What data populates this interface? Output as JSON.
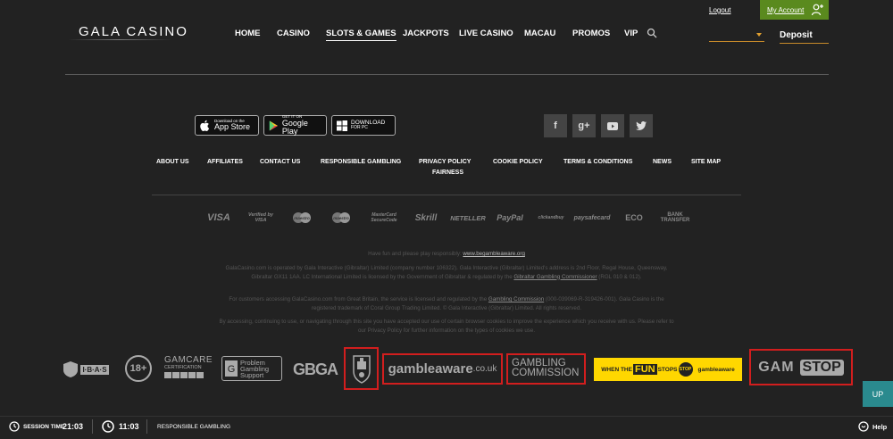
{
  "header": {
    "logo": "GALA CASINO",
    "nav": [
      "HOME",
      "CASINO",
      "SLOTS & GAMES",
      "JACKPOTS",
      "LIVE CASINO",
      "MACAU",
      "PROMOS",
      "VIP"
    ],
    "active_nav": "SLOTS & GAMES",
    "logout": "Logout",
    "my_account": "My Account",
    "deposit": "Deposit",
    "dropdown_value": ""
  },
  "apps": {
    "app_store": {
      "small": "Download on the",
      "big": "App Store"
    },
    "google_play": {
      "small": "GET IT ON",
      "big": "Google Play"
    },
    "windows": {
      "small": "DOWNLOAD",
      "big": "FOR PC"
    }
  },
  "social": [
    "f",
    "g+",
    "yt",
    "tw"
  ],
  "footer_links": [
    "ABOUT US",
    "AFFILIATES",
    "CONTACT US",
    "RESPONSIBLE GAMBLING",
    "PRIVACY POLICY",
    "FAIRNESS",
    "COOKIE POLICY",
    "TERMS & CONDITIONS",
    "NEWS",
    "SITE MAP"
  ],
  "payments": [
    "VISA",
    "Verified by VISA",
    "maestro",
    "maestro",
    "MasterCard SecureCode",
    "Skrill",
    "NETELLER",
    "PayPal",
    "clickandbuy",
    "paysafecard",
    "ECO",
    "BANK TRANSFER"
  ],
  "legal": {
    "line1_prefix": "Have fun and please play responsibly: ",
    "line1_link": "www.begambleaware.org",
    "para1": "GalaCasino.com is operated by Gala Interactive (Gibraltar) Limited (company number 106322). Gala Interactive (Gibraltar) Limited's address is 2nd Floor, Regal House, Queensway, Gibraltar GX11 1AA. LC International Limited is licensed by the Government of Gibraltar & regulated by the",
    "para1_link": "Gibraltar Gambling Commissioner",
    "para1_suffix": " (RGL 010 & 012).",
    "para2_prefix": "For customers accessing GalaCasino.com from Great Britain, the service is licensed and regulated by the ",
    "para2_link": "Gambling Commission",
    "para2_suffix": " (000-039069-R-319426-001). Gala Casino is the registered trademark of Coral Group Trading Limited. © Gala Interactive (Gibraltar) Limited. All rights reserved.",
    "para3": "By accessing, continuing to use, or navigating through this site you have accepted our use of certain browser cookies to improve the experience which you receive with us. Please refer to our Privacy Policy for further information on the types of cookies we use."
  },
  "badges": {
    "ibas": "I·B·A·S",
    "age": "18+",
    "gamcare_top": "GAMCARE",
    "gamcare_bottom": "CERTIFICATION",
    "pgs": [
      "Problem",
      "Gambling",
      "Support"
    ],
    "gbga": "GBGA",
    "gambleaware_main": "gambleaware",
    "gambleaware_suffix": ".co.uk",
    "gc_top": "GAMBLING",
    "gc_bottom": "COMMISSION",
    "fun_prefix": "WHEN THE ",
    "fun_word": "FUN",
    "fun_middle": " STOPS ",
    "fun_stop": "STOP",
    "fun_site": "gambleaware",
    "gamstop_left": "GAM",
    "gamstop_right": "STOP"
  },
  "bottom_bar": {
    "session_label": "SESSION TIME",
    "session_value": "21:03",
    "clock_value": "11:03",
    "responsible": "RESPONSIBLE GAMBLING",
    "up": "UP",
    "help": "Help"
  },
  "colors": {
    "background": "#222222",
    "account_green": "#5a8a1e",
    "deposit_underline": "#c78a2a",
    "up_teal": "#2a8a8e",
    "highlight_red": "#d21e1e",
    "fun_yellow": "#ffd700"
  }
}
